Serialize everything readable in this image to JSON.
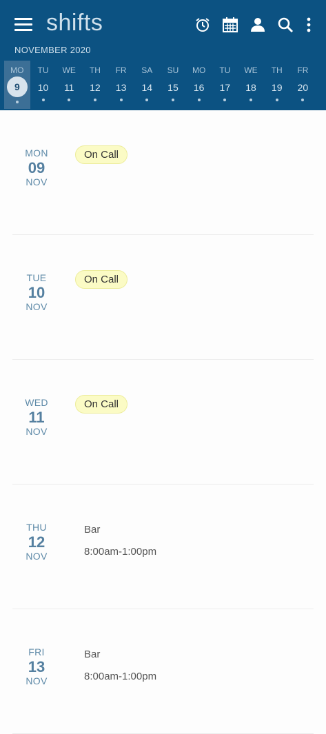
{
  "app": {
    "title": "shifts"
  },
  "header": {
    "month_label": "NOVEMBER 2020"
  },
  "strip": [
    {
      "dow": "MO",
      "num": "9",
      "selected": true
    },
    {
      "dow": "TU",
      "num": "10"
    },
    {
      "dow": "WE",
      "num": "11"
    },
    {
      "dow": "TH",
      "num": "12"
    },
    {
      "dow": "FR",
      "num": "13"
    },
    {
      "dow": "SA",
      "num": "14"
    },
    {
      "dow": "SU",
      "num": "15"
    },
    {
      "dow": "MO",
      "num": "16"
    },
    {
      "dow": "TU",
      "num": "17"
    },
    {
      "dow": "WE",
      "num": "18"
    },
    {
      "dow": "TH",
      "num": "19"
    },
    {
      "dow": "FR",
      "num": "20"
    }
  ],
  "days": [
    {
      "dow": "MON",
      "num": "09",
      "mon": "NOV",
      "pill": "On Call"
    },
    {
      "dow": "TUE",
      "num": "10",
      "mon": "NOV",
      "pill": "On Call"
    },
    {
      "dow": "WED",
      "num": "11",
      "mon": "NOV",
      "pill": "On Call"
    },
    {
      "dow": "THU",
      "num": "12",
      "mon": "NOV",
      "shift": "Bar",
      "time": "8:00am-1:00pm"
    },
    {
      "dow": "FRI",
      "num": "13",
      "mon": "NOV",
      "shift": "Bar",
      "time": "8:00am-1:00pm"
    }
  ],
  "colors": {
    "header_bg": "#0c5282",
    "pill_bg": "#fbfbc5"
  }
}
